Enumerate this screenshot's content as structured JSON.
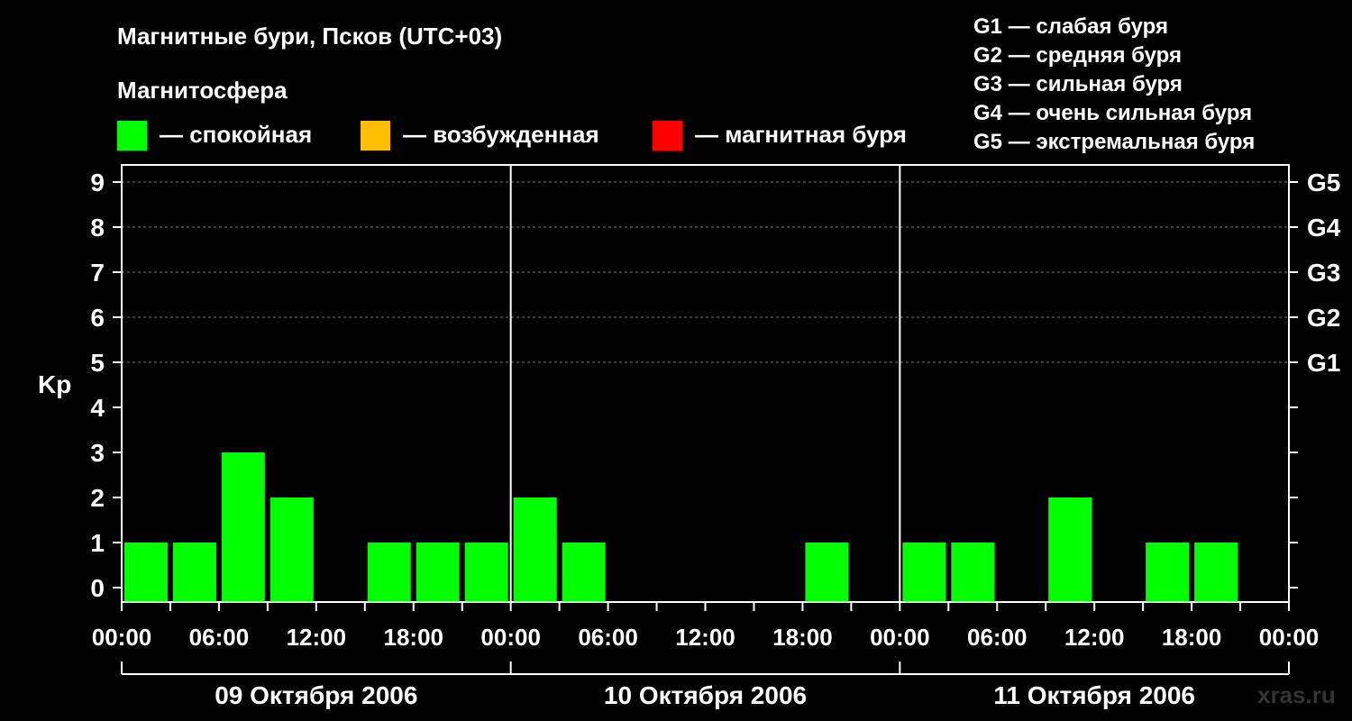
{
  "title": "Магнитные бури, Псков (UTC+03)",
  "magnetosphere_label": "Магнитосфера",
  "state_legend": [
    {
      "label": "— спокойная",
      "color": "#00ff00"
    },
    {
      "label": "— возбужденная",
      "color": "#ffbf00"
    },
    {
      "label": "— магнитная буря",
      "color": "#ff0000"
    }
  ],
  "g_legend": [
    "G1 — слабая буря",
    "G2 — средняя буря",
    "G3 — сильная буря",
    "G4 — очень сильная буря",
    "G5 — экстремальная буря"
  ],
  "watermark": "xras.ru",
  "chart_data": {
    "type": "bar",
    "ylabel": "Kp",
    "ylim": [
      0,
      9
    ],
    "y_ticks": [
      0,
      1,
      2,
      3,
      4,
      5,
      6,
      7,
      8,
      9
    ],
    "right_axis_labels": [
      {
        "kp": 5,
        "label": "G1"
      },
      {
        "kp": 6,
        "label": "G2"
      },
      {
        "kp": 7,
        "label": "G3"
      },
      {
        "kp": 8,
        "label": "G4"
      },
      {
        "kp": 9,
        "label": "G5"
      }
    ],
    "grid": "dashed horizontal at Kp 5–9",
    "x_tick_labels": [
      "00:00",
      "06:00",
      "12:00",
      "18:00",
      "00:00",
      "06:00",
      "12:00",
      "18:00",
      "00:00",
      "06:00",
      "12:00",
      "18:00",
      "00:00"
    ],
    "days": [
      "09 Октября 2006",
      "10 Октября 2006",
      "11 Октября 2006"
    ],
    "categories": [
      "09.10 00:00",
      "09.10 03:00",
      "09.10 06:00",
      "09.10 09:00",
      "09.10 12:00",
      "09.10 15:00",
      "09.10 18:00",
      "09.10 21:00",
      "10.10 00:00",
      "10.10 03:00",
      "10.10 06:00",
      "10.10 09:00",
      "10.10 12:00",
      "10.10 15:00",
      "10.10 18:00",
      "10.10 21:00",
      "11.10 00:00",
      "11.10 03:00",
      "11.10 06:00",
      "11.10 09:00",
      "11.10 12:00",
      "11.10 15:00",
      "11.10 18:00",
      "11.10 21:00"
    ],
    "values": [
      1,
      1,
      3,
      2,
      0,
      1,
      1,
      1,
      2,
      1,
      0,
      0,
      0,
      0,
      1,
      0,
      1,
      1,
      0,
      2,
      0,
      1,
      1,
      0
    ],
    "bar_color": "#00ff00"
  }
}
